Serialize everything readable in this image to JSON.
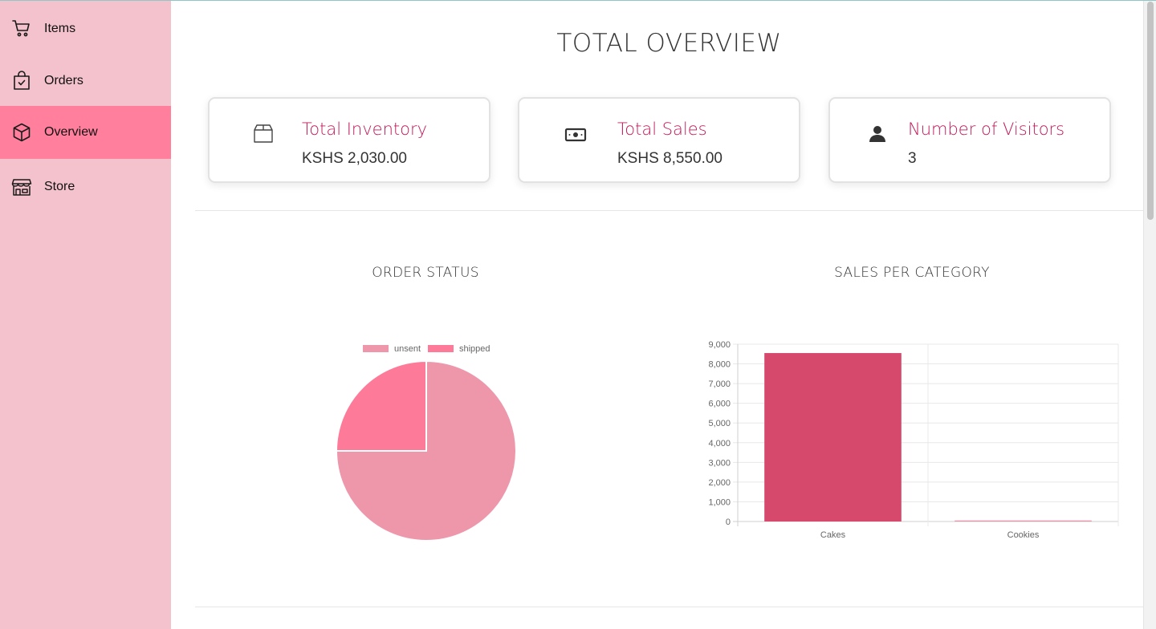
{
  "sidebar": {
    "items": [
      {
        "label": "Items",
        "icon": "cart-icon",
        "active": false
      },
      {
        "label": "Orders",
        "icon": "shopping-bag-check-icon",
        "active": false
      },
      {
        "label": "Overview",
        "icon": "box-3d-icon",
        "active": true
      },
      {
        "label": "Store",
        "icon": "storefront-icon",
        "active": false
      }
    ]
  },
  "header": {
    "title": "TOTAL OVERVIEW"
  },
  "cards": [
    {
      "title": "Total Inventory",
      "value": "KSHS 2,030.00",
      "icon": "package-icon"
    },
    {
      "title": "Total Sales",
      "value": "KSHS 8,550.00",
      "icon": "cash-icon"
    },
    {
      "title": "Number of Visitors",
      "value": "3",
      "icon": "person-icon"
    }
  ],
  "colors": {
    "sidebar_bg": "#f4c2cc",
    "active_bg": "#ff7f9c",
    "accent": "#c2185b",
    "pie_unsent": "#ee97ab",
    "pie_shipped": "#fd7b98",
    "bar_cakes": "#d7486d",
    "bar_cookies": "#ef8fa7"
  },
  "charts": {
    "order_status_title": "ORDER STATUS",
    "sales_category_title": "SALES PER CATEGORY"
  },
  "chart_data": [
    {
      "type": "pie",
      "title": "ORDER STATUS",
      "legend_position": "top",
      "labels": [
        "unsent",
        "shipped"
      ],
      "values": [
        3,
        1
      ],
      "colors": [
        "#ee97ab",
        "#fd7b98"
      ]
    },
    {
      "type": "bar",
      "title": "SALES PER CATEGORY",
      "categories": [
        "Cakes",
        "Cookies"
      ],
      "series": [
        {
          "values": [
            8550,
            50
          ]
        }
      ],
      "colors": [
        "#d7486d",
        "#ef8fa7"
      ],
      "ylim": [
        0,
        9000
      ],
      "yticks": [
        "0",
        "1,000",
        "2,000",
        "3,000",
        "4,000",
        "5,000",
        "6,000",
        "7,000",
        "8,000",
        "9,000"
      ],
      "grid": true
    }
  ]
}
